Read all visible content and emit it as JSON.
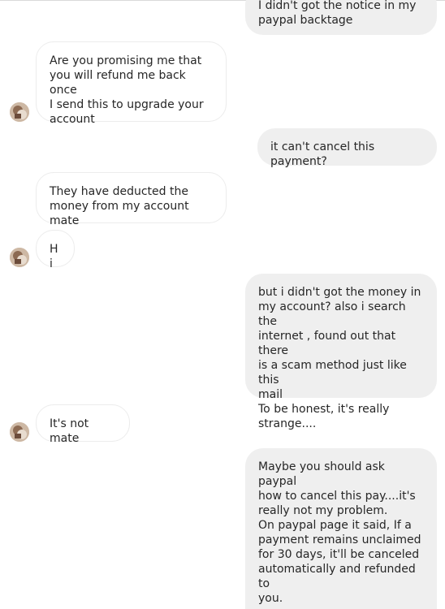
{
  "conversation": {
    "messages": [
      {
        "from": "me",
        "text": "I didn't got the notice in my\npaypal backtage"
      },
      {
        "from": "them",
        "text": "Are you promising me that\nyou will refund me back once\nI send this to upgrade your\naccount"
      },
      {
        "from": "me",
        "text": "it can't cancel this payment?"
      },
      {
        "from": "them",
        "text": "They have deducted the\nmoney from my account mate"
      },
      {
        "from": "them",
        "text": "Hi"
      },
      {
        "from": "me",
        "text": "but i didn't got the money in\nmy account? also i search the\ninternet , found out that there\nis a scam method just like this\nmail\nTo be honest, it's really\nstrange...."
      },
      {
        "from": "them",
        "text": "It's not mate"
      },
      {
        "from": "me",
        "text": "Maybe you should ask paypal\nhow to cancel this pay....it's\nreally not my problem.\nOn paypal page it said, If a\npayment remains unclaimed\nfor 30 days, it'll be canceled\nautomatically and refunded to\nyou.\n\nAnd honestly, I didn't get any"
      }
    ],
    "avatar_icon": "user-avatar-icon",
    "colors": {
      "outgoing_bubble": "#efefef",
      "incoming_bubble": "#ffffff",
      "incoming_border": "#ececec",
      "text": "#262626"
    }
  }
}
